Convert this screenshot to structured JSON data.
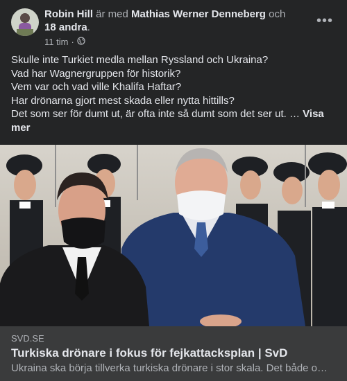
{
  "post": {
    "author": "Robin Hill",
    "with_text": "är med",
    "tagged_person": "Mathias Werner Denneberg",
    "and_text": "och",
    "others": "18 andra",
    "time": "11 tim",
    "privacy_icon": "globe-icon",
    "more_icon": "more-horizontal-icon",
    "lines": [
      "Skulle inte Turkiet medla mellan Ryssland och Ukraina?",
      "Vad har Wagnergruppen för historik?",
      "Vem var och vad ville Khalifa Haftar?",
      "Har drönarna gjort mest skada eller nytta hittills?",
      "Det som ser för dumt ut, är ofta inte så dumt som det ser ut. …"
    ],
    "see_more": "Visa mer"
  },
  "link": {
    "domain": "SVD.SE",
    "title": "Turkiska drönare i fokus för fejkattacksplan | SvD",
    "description": "Ukraina ska börja tillverka turkiska drönare i stor skala. Det både o…"
  },
  "colors": {
    "card_bg": "#242526",
    "link_bg": "#3a3b3c",
    "primary_text": "#e4e6eb",
    "secondary_text": "#b0b3b8"
  }
}
